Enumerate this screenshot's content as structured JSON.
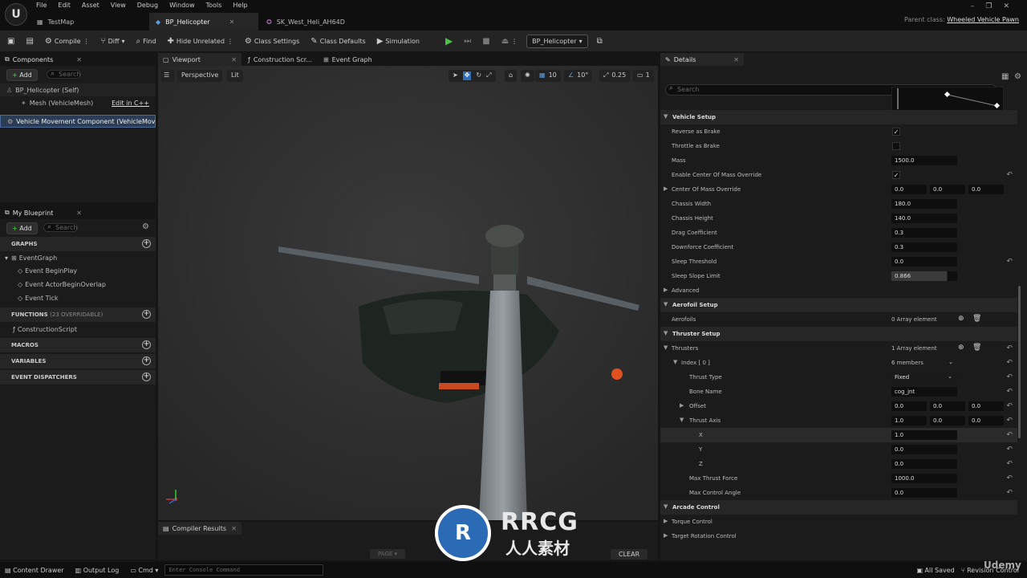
{
  "menu": [
    "File",
    "Edit",
    "Asset",
    "View",
    "Debug",
    "Window",
    "Tools",
    "Help"
  ],
  "tabs": [
    {
      "label": "TestMap"
    },
    {
      "label": "BP_Helicopter"
    },
    {
      "label": "SK_West_Heli_AH64D"
    }
  ],
  "parent_class": {
    "label": "Parent class:",
    "value": "Wheeled Vehicle Pawn"
  },
  "toolbar": {
    "compile": "Compile",
    "diff": "Diff",
    "find": "Find",
    "hide_unrelated": "Hide Unrelated",
    "class_settings": "Class Settings",
    "class_defaults": "Class Defaults",
    "simulation": "Simulation",
    "blueprint": "BP_Helicopter"
  },
  "components": {
    "title": "Components",
    "add": "Add",
    "search": "Search",
    "items": [
      "BP_Helicopter (Self)",
      "Mesh (VehicleMesh)",
      "Vehicle Movement Component (VehicleMovementComp)"
    ],
    "edit_cpp": "Edit in C++"
  },
  "my_blueprint": {
    "title": "My Blueprint",
    "add": "Add",
    "search": "Search",
    "graphs": "GRAPHS",
    "event_graph": "EventGraph",
    "events": [
      "Event BeginPlay",
      "Event ActorBeginOverlap",
      "Event Tick"
    ],
    "functions": "FUNCTIONS",
    "functions_sub": "(23 OVERRIDABLE)",
    "construction": "ConstructionScript",
    "macros": "MACROS",
    "variables": "VARIABLES",
    "dispatchers": "EVENT DISPATCHERS"
  },
  "viewport_tabs": [
    "Viewport",
    "Construction Scr...",
    "Event Graph"
  ],
  "viewport": {
    "perspective": "Perspective",
    "lit": "Lit",
    "grid": "10",
    "angle": "10°",
    "scale": "0.25",
    "cam": "1"
  },
  "compiler": {
    "title": "Compiler Results",
    "page": "PAGE",
    "clear": "CLEAR"
  },
  "details": {
    "title": "Details",
    "search": "Search",
    "rows": [
      {
        "type": "section",
        "label": "Vehicle Setup"
      },
      {
        "type": "check",
        "label": "Reverse as Brake",
        "checked": true
      },
      {
        "type": "check",
        "label": "Throttle as Brake",
        "checked": false
      },
      {
        "type": "field",
        "label": "Mass",
        "value": "1500.0"
      },
      {
        "type": "check",
        "label": "Enable Center Of Mass Override",
        "checked": true,
        "reset": true
      },
      {
        "type": "vec",
        "label": "Center Of Mass Override",
        "values": [
          "0.0",
          "0.0",
          "0.0"
        ],
        "expand": true
      },
      {
        "type": "field",
        "label": "Chassis Width",
        "value": "180.0"
      },
      {
        "type": "field",
        "label": "Chassis Height",
        "value": "140.0"
      },
      {
        "type": "field",
        "label": "Drag Coefficient",
        "value": "0.3"
      },
      {
        "type": "field",
        "label": "Downforce Coefficient",
        "value": "0.3"
      },
      {
        "type": "field",
        "label": "Sleep Threshold",
        "value": "0.0",
        "reset": true
      },
      {
        "type": "field",
        "label": "Sleep Slope Limit",
        "value": "0.866"
      },
      {
        "type": "plain",
        "label": "Advanced",
        "expand": true
      },
      {
        "type": "section",
        "label": "Aerofoil Setup"
      },
      {
        "type": "array",
        "label": "Aerofoils",
        "value": "0 Array element"
      },
      {
        "type": "section",
        "label": "Thruster Setup"
      },
      {
        "type": "array",
        "label": "Thrusters",
        "value": "1 Array element",
        "reset": true,
        "open": true
      },
      {
        "type": "index",
        "label": "Index [ 0 ]",
        "value": "6 members",
        "reset": true
      },
      {
        "type": "select",
        "label": "Thrust Type",
        "value": "Fixed",
        "reset": true
      },
      {
        "type": "field2",
        "label": "Bone Name",
        "value": "cog_jnt",
        "reset": true
      },
      {
        "type": "vec2",
        "label": "Offset",
        "values": [
          "0.0",
          "0.0",
          "0.0"
        ],
        "reset": true
      },
      {
        "type": "vec2",
        "label": "Thrust Axis",
        "values": [
          "1.0",
          "0.0",
          "0.0"
        ],
        "reset": true,
        "open": true
      },
      {
        "type": "axis",
        "label": "X",
        "value": "1.0",
        "reset": true,
        "hl": true
      },
      {
        "type": "axis",
        "label": "Y",
        "value": "0.0",
        "reset": true
      },
      {
        "type": "axis",
        "label": "Z",
        "value": "0.0",
        "reset": true
      },
      {
        "type": "field2",
        "label": "Max Thrust Force",
        "value": "1000.0",
        "reset": true
      },
      {
        "type": "field2",
        "label": "Max Control Angle",
        "value": "0.0",
        "reset": true
      },
      {
        "type": "section",
        "label": "Arcade Control"
      },
      {
        "type": "plain",
        "label": "Torque Control",
        "expand": true
      },
      {
        "type": "plain",
        "label": "Target Rotation Control",
        "expand": true
      }
    ]
  },
  "bottom": {
    "content_drawer": "Content Drawer",
    "output_log": "Output Log",
    "cmd": "Cmd",
    "console": "Enter Console Command",
    "saved": "All Saved",
    "revision": "Revision Control"
  },
  "watermark": {
    "brand": "RRCG",
    "sub": "人人素材",
    "udemy": "Udemy"
  }
}
